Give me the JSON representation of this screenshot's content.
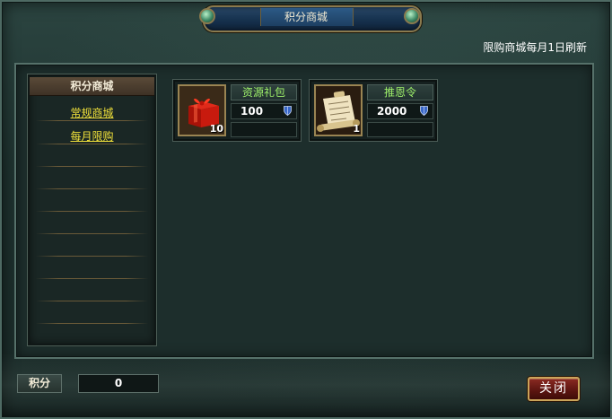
{
  "window": {
    "title": "积分商城"
  },
  "header": {
    "notice": "限购商城每月1日刷新"
  },
  "sidebar": {
    "header": "积分商城",
    "items": [
      {
        "label": "常规商城"
      },
      {
        "label": "每月限购"
      }
    ]
  },
  "items": [
    {
      "name": "资源礼包",
      "price": "100",
      "quantity": "10",
      "icon": "gift-box-icon",
      "currency_icon": "shield-icon"
    },
    {
      "name": "推恩令",
      "price": "2000",
      "quantity": "1",
      "icon": "scroll-icon",
      "currency_icon": "shield-icon"
    }
  ],
  "footer": {
    "points_label": "积分",
    "points_value": "0",
    "close_label": "关闭"
  },
  "colors": {
    "item_name": "#9ef06a",
    "link": "#f0e13a",
    "close_button": "#8a2a22"
  }
}
